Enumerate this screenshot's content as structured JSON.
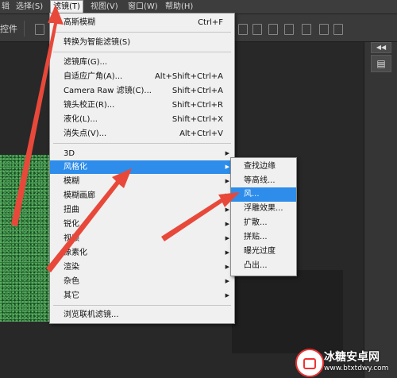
{
  "menubar": {
    "partial_left": "辑",
    "items": [
      {
        "label": "选择(S)"
      },
      {
        "label": "滤镜(T)"
      },
      {
        "label": "视图(V)"
      },
      {
        "label": "窗口(W)"
      },
      {
        "label": "帮助(H)"
      }
    ]
  },
  "options_bar": {
    "label": "控件"
  },
  "filter_menu": {
    "items": [
      {
        "label": "高斯模糊",
        "shortcut": "Ctrl+F"
      },
      {
        "label": "转换为智能滤镜(S)"
      },
      {
        "label": "滤镜库(G)..."
      },
      {
        "label": "自适应广角(A)...",
        "shortcut": "Alt+Shift+Ctrl+A"
      },
      {
        "label": "Camera Raw 滤镜(C)...",
        "shortcut": "Shift+Ctrl+A"
      },
      {
        "label": "镜头校正(R)...",
        "shortcut": "Shift+Ctrl+R"
      },
      {
        "label": "液化(L)...",
        "shortcut": "Shift+Ctrl+X"
      },
      {
        "label": "消失点(V)...",
        "shortcut": "Alt+Ctrl+V"
      },
      {
        "label": "3D"
      },
      {
        "label": "风格化"
      },
      {
        "label": "模糊"
      },
      {
        "label": "模糊画廊"
      },
      {
        "label": "扭曲"
      },
      {
        "label": "锐化"
      },
      {
        "label": "视频"
      },
      {
        "label": "像素化"
      },
      {
        "label": "渲染"
      },
      {
        "label": "杂色"
      },
      {
        "label": "其它"
      },
      {
        "label": "浏览联机滤镜..."
      }
    ]
  },
  "stylize_menu": {
    "items": [
      {
        "label": "查找边缘"
      },
      {
        "label": "等高线..."
      },
      {
        "label": "风..."
      },
      {
        "label": "浮雕效果..."
      },
      {
        "label": "扩散..."
      },
      {
        "label": "拼贴..."
      },
      {
        "label": "曝光过度"
      },
      {
        "label": "凸出..."
      }
    ]
  },
  "icons": {
    "submenu_arrow": "▶",
    "panel_expand": "◀◀",
    "panel_tool": "▤"
  },
  "watermark": {
    "title": "冰糖安卓网",
    "url": "www.btxtdwy.com"
  },
  "colors": {
    "highlight": "#2e8dea",
    "arrow": "#e8483a",
    "canvas": "#2c7a3a"
  }
}
